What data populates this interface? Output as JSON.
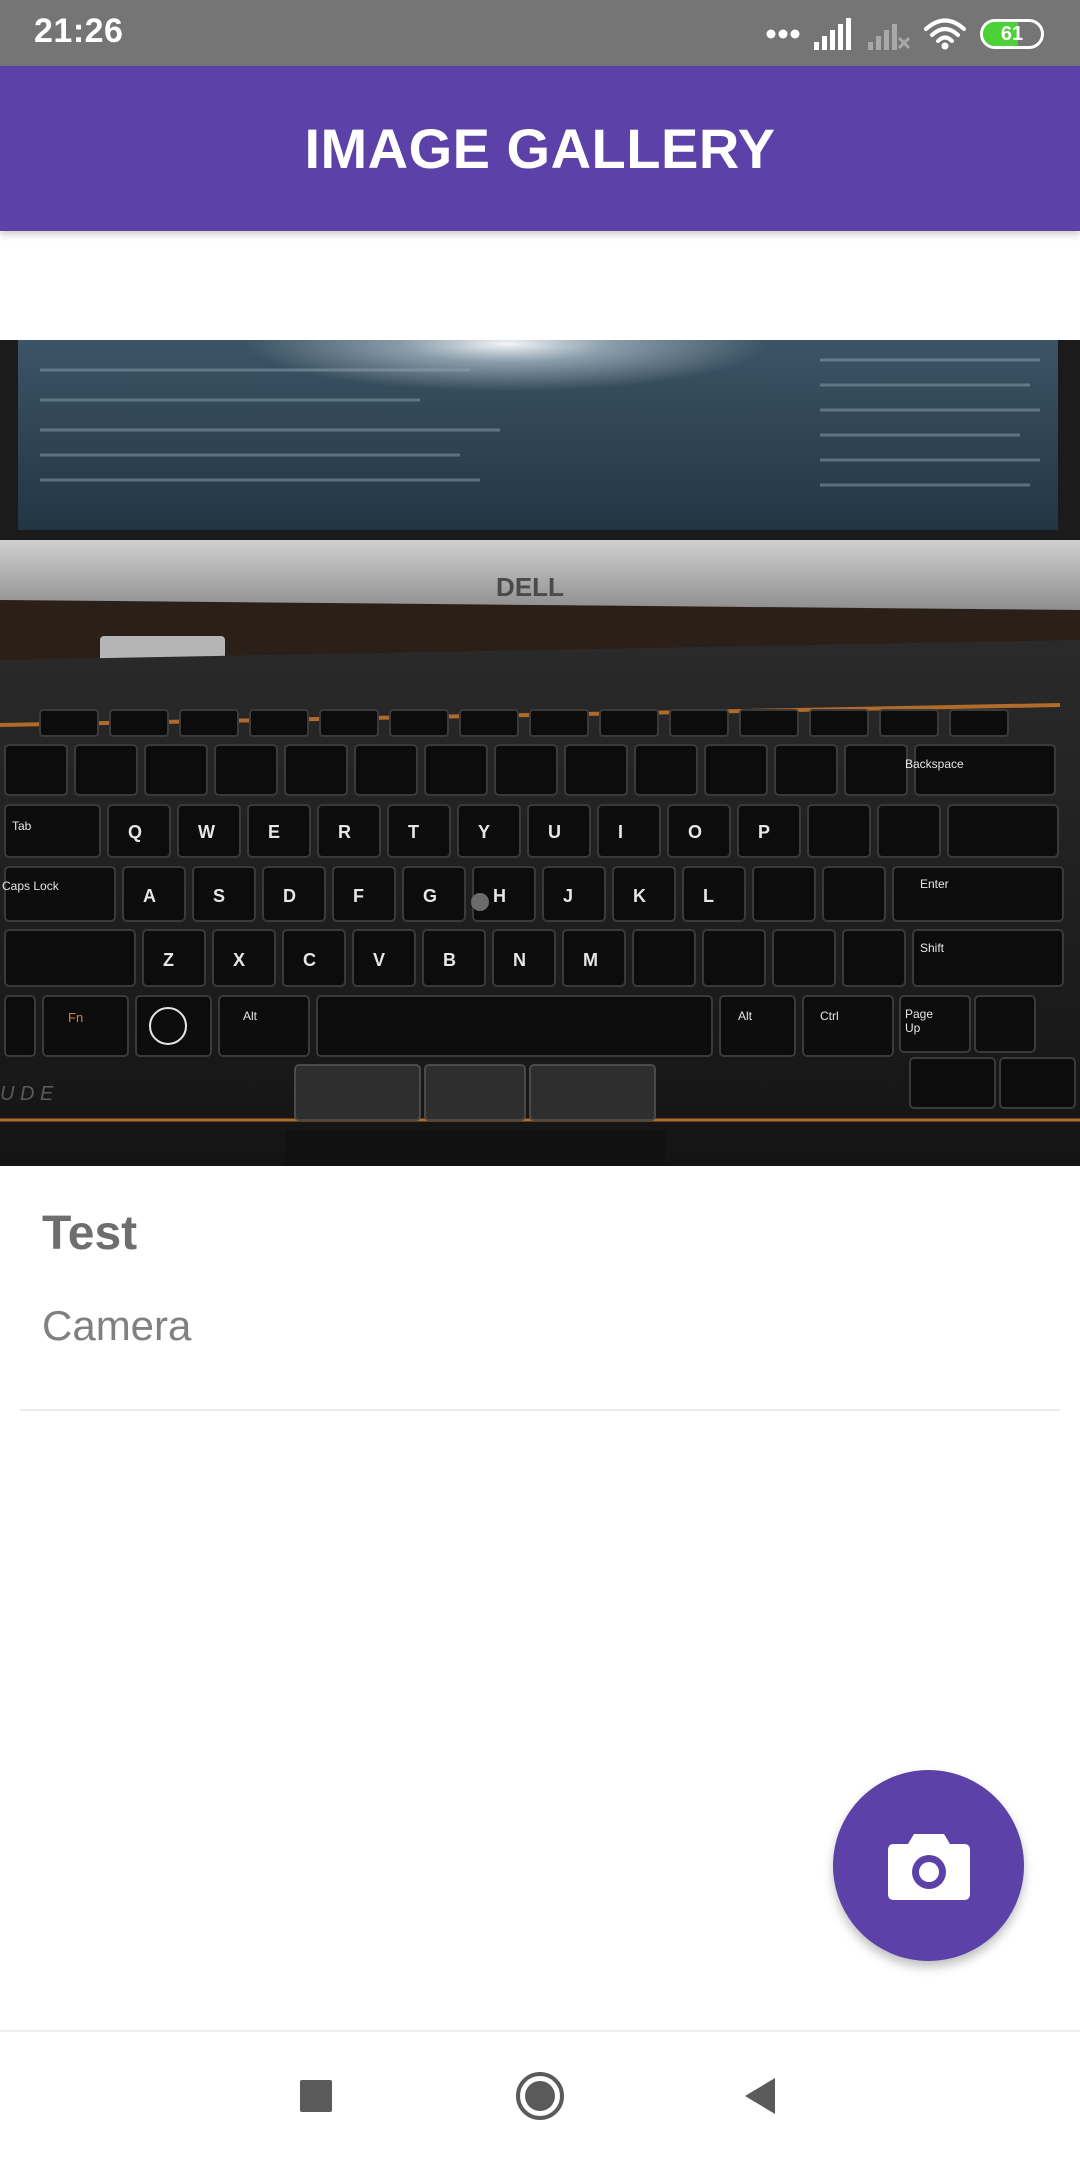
{
  "status_bar": {
    "time": "21:26",
    "battery_level": "61",
    "battery_fraction": 0.61,
    "icons": [
      "more-dots-icon",
      "signal-icon",
      "signal-no-service-icon",
      "wifi-icon",
      "battery-icon"
    ]
  },
  "app_bar": {
    "title": "IMAGE GALLERY"
  },
  "gallery": {
    "items": [
      {
        "image": "laptop-keyboard-photo",
        "title": "Test",
        "subtitle": "Camera"
      }
    ]
  },
  "fab": {
    "icon": "camera-icon"
  },
  "nav_bar": {
    "buttons": [
      "recents-square-icon",
      "home-circle-icon",
      "back-triangle-icon"
    ]
  },
  "colors": {
    "primary": "#5c42a8",
    "status_bar": "#757575",
    "battery_fill": "#4cd137",
    "title_text": "#6e6e6e",
    "subtitle_text": "#808080"
  }
}
